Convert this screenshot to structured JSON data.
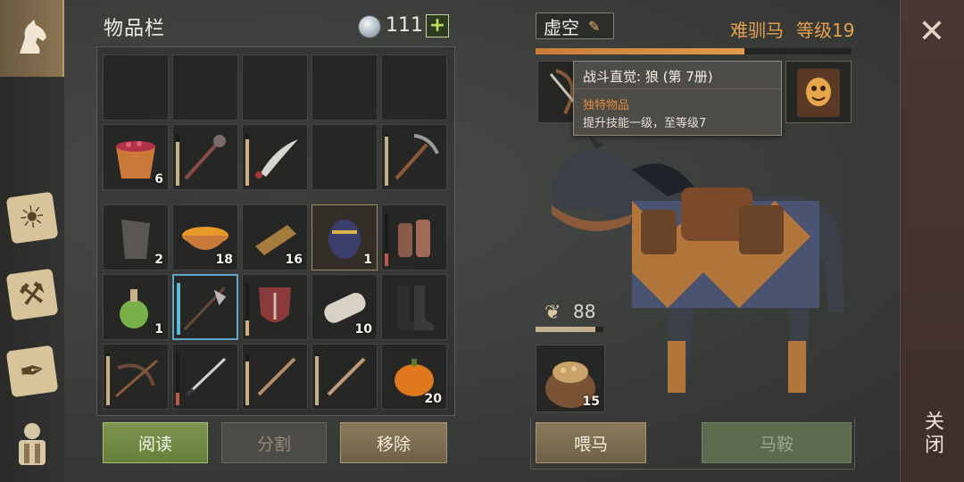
{
  "inventory": {
    "title": "物品栏",
    "currency": "111",
    "plus_label": "+",
    "slots": [
      {
        "icon": "empty-slot",
        "qty": ""
      },
      {
        "icon": "empty-slot",
        "qty": ""
      },
      {
        "icon": "empty-slot",
        "qty": ""
      },
      {
        "icon": "empty-slot",
        "qty": ""
      },
      {
        "icon": "empty-slot",
        "qty": ""
      },
      {
        "icon": "berry-bowl-icon",
        "qty": "6"
      },
      {
        "icon": "mace-icon",
        "qty": ""
      },
      {
        "icon": "scimitar-icon",
        "qty": ""
      },
      {
        "icon": "empty-slot",
        "qty": ""
      },
      {
        "icon": "pickaxe-icon",
        "qty": ""
      },
      {
        "icon": "shoulder-armor-icon",
        "qty": "2"
      },
      {
        "icon": "soup-bowl-icon",
        "qty": "18"
      },
      {
        "icon": "bread-icon",
        "qty": "16"
      },
      {
        "icon": "egg-icon",
        "qty": "1"
      },
      {
        "icon": "gloves-icon",
        "qty": ""
      },
      {
        "icon": "potion-icon",
        "qty": "1"
      },
      {
        "icon": "halberd-icon",
        "qty": ""
      },
      {
        "icon": "shield-icon",
        "qty": ""
      },
      {
        "icon": "log-icon",
        "qty": "10"
      },
      {
        "icon": "boots-icon",
        "qty": ""
      },
      {
        "icon": "crossbow-icon",
        "qty": ""
      },
      {
        "icon": "katana-icon",
        "qty": ""
      },
      {
        "icon": "sword-icon",
        "qty": ""
      },
      {
        "icon": "longsword-icon",
        "qty": ""
      },
      {
        "icon": "pumpkin-icon",
        "qty": "20"
      }
    ]
  },
  "buttons": {
    "read": "阅读",
    "split": "分割",
    "remove": "移除",
    "feed": "喂马",
    "saddle": "马鞍",
    "close": "关闭"
  },
  "horse": {
    "tag": "虚空",
    "name": "难驯马",
    "level": "等级19",
    "xp_fraction": 0.66,
    "food_value": "88",
    "food_fraction": 0.88,
    "feed_qty": "15"
  },
  "tooltip": {
    "title": "战斗直觉: 狼 (第 7册)",
    "subtitle": "独特物品",
    "description": "提升技能一级，至等级7"
  },
  "nav": [
    "horse-icon",
    "sun-book-icon",
    "hammer-map-icon",
    "feather-scroll-icon",
    "backpack-icon"
  ]
}
